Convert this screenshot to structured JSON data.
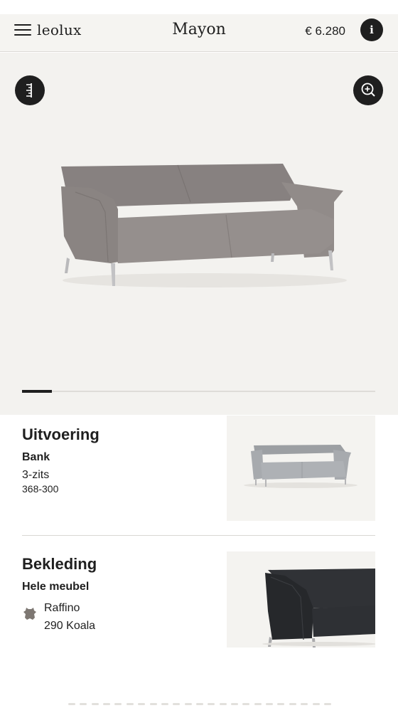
{
  "header": {
    "brand": "leolux",
    "title": "Mayon",
    "price": "€ 6.280",
    "info_label": "i"
  },
  "hero": {
    "image_alt": "Mayon sofa grey",
    "carousel_progress": 0.085
  },
  "uitvoering": {
    "heading": "Uitvoering",
    "type": "Bank",
    "variant": "3-zits",
    "code": "368-300"
  },
  "bekleding": {
    "heading": "Bekleding",
    "area": "Hele meubel",
    "material": "Raffino",
    "color": "290 Koala"
  },
  "colors": {
    "dark": "#1f1f1f",
    "hero_bg": "#f3f2ef",
    "sofa": "#8d8683",
    "leather": "#2b2d30"
  }
}
